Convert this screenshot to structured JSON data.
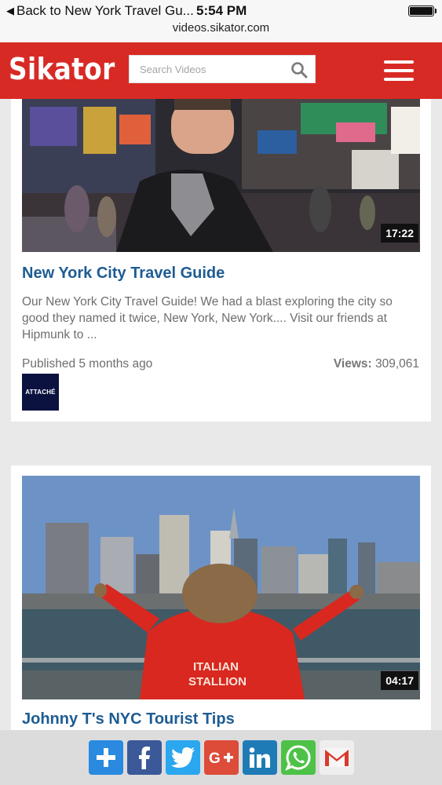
{
  "status_bar": {
    "back_label": "Back to New York Travel Gu...",
    "time": "5:54 PM",
    "url": "videos.sikator.com"
  },
  "header": {
    "logo": "Sikator",
    "search_placeholder": "Search Videos",
    "brand_color": "#d82a25"
  },
  "videos": [
    {
      "title": "New York City Travel Guide",
      "duration": "17:22",
      "description": "Our New York City Travel Guide! We had a blast exploring the city so good they named it twice, New York, New York.... Visit our friends at Hipmunk to ...",
      "published": "Published 5 months ago",
      "views_label": "Views:",
      "views_value": "309,061",
      "channel_logo_text": "ATTACHÉ"
    },
    {
      "title": "Johnny T's NYC Tourist Tips",
      "duration": "04:17",
      "jacket_text_line1": "ITALIAN",
      "jacket_text_line2": "STALLION"
    }
  ],
  "share_bar": {
    "buttons": [
      {
        "icon": "plus-icon",
        "color": "#2a8ae0"
      },
      {
        "icon": "facebook-icon",
        "color": "#3b5998"
      },
      {
        "icon": "twitter-icon",
        "color": "#2aa7ee"
      },
      {
        "icon": "google-plus-icon",
        "color": "#dd4b39"
      },
      {
        "icon": "linkedin-icon",
        "color": "#1f7bb6"
      },
      {
        "icon": "whatsapp-icon",
        "color": "#4dc247"
      },
      {
        "icon": "gmail-icon",
        "color": "#eeeeee"
      }
    ]
  }
}
